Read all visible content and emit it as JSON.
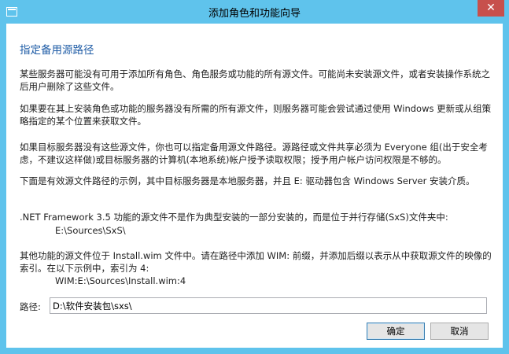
{
  "window": {
    "title": "添加角色和功能向导",
    "close_glyph": "✕",
    "titlebar_color": "#5fc3ec",
    "close_color": "#c7504c"
  },
  "dialog": {
    "heading": "指定备用源路径",
    "paragraphs": [
      "某些服务器可能没有可用于添加所有角色、角色服务或功能的所有源文件。可能尚未安装源文件，或者安装操作系统之后用户删除了这些文件。",
      "如果要在其上安装角色或功能的服务器没有所需的所有源文件，则服务器可能会尝试通过使用 Windows 更新或从组策略指定的某个位置来获取文件。",
      "如果目标服务器没有这些源文件，你也可以指定备用源文件路径。源路径或文件共享必须为 Everyone 组(出于安全考虑，不建议这样做)或目标服务器的计算机(本地系统)帐户授予读取权限；授予用户帐户访问权限是不够的。",
      "下面是有效源文件路径的示例，其中目标服务器是本地服务器，并且 E: 驱动器包含 Windows Server 安装介质。",
      ".NET Framework 3.5 功能的源文件不是作为典型安装的一部分安装的，而是位于并行存储(SxS)文件夹中:",
      "E:\\Sources\\SxS\\",
      "其他功能的源文件位于 Install.wim 文件中。请在路径中添加 WIM: 前缀，并添加后缀以表示从中获取源文件的映像的索引。在以下示例中，索引为 4:",
      "WIM:E:\\Sources\\Install.wim:4"
    ],
    "path_label": "路径:",
    "path_value": "D:\\软件安装包\\sxs\\",
    "heading_color": "#1f5ca6"
  },
  "buttons": {
    "ok_label": "确定",
    "cancel_label": "取消"
  }
}
